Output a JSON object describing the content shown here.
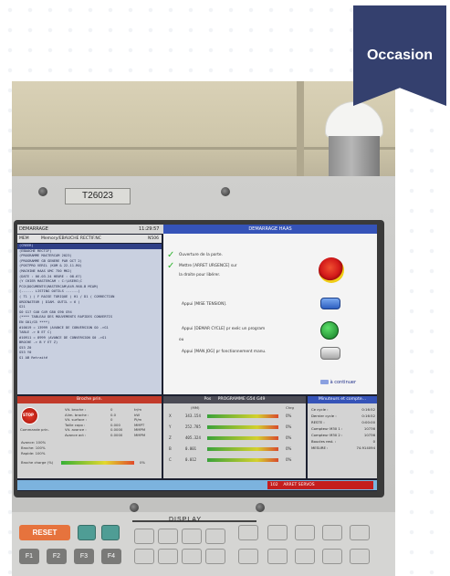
{
  "badge": {
    "label": "Occasion"
  },
  "machine": {
    "plate": "T26023"
  },
  "screen": {
    "header": {
      "left_label": "DEMARRAGE",
      "clock": "11:29:57",
      "dialog_title": "DEMARRAGE HAAS"
    },
    "subheader": {
      "mode": "MEM",
      "program": "Memory/EBAUCHE RECTIF.NC",
      "n": "N506"
    },
    "program_lines": [
      "(CREER)",
      "(EBAUCHE RECTIF)",
      "(PROGRAMME MASTERCAM 2023)",
      "(PROGRAMME GB GENERE PAR OCT 2)",
      "(POSTPRO VERIL (KOM & 22.11.R0)",
      "(MACHINE HAAS UMC 750 MK2)",
      "(DATE : 06.03.24 HEURE : 08.67)",
      "(Y CHIER MASTERCAM : C:\\USERS\\C",
      "PCO\\DOCUMENTS\\MASTERCAM\\649-968-B MCAM)",
      "",
      "(------ LISTING OUTILS ------)",
      "( T1 ) ( F RAISE TORIQUE ) H1 / D1 ( CORRECTION",
      "ORDINATEUR ) DIAM. OUTIL = 6 )",
      "",
      "G21",
      "G0 G17 G40 G49 G80 G90 G94",
      "",
      "(**** TABLEAU DES MOUVEMENTS RAPIDES CONVERTIS",
      "EN G01/G5 ****)",
      "#10019 = 13999 (AVANCE DE CONVERSION G0 ->G1",
      "TABLE -> B ET C)",
      "#10911 = 8999 (AVANCE DE CONVERSION G0 ->G1",
      "BROCHE -> B Y ET Z)",
      "",
      "G53 Z0",
      "G53 Y0",
      "G1 AB Retraité"
    ],
    "startup_steps": [
      "Ouverture de la porte.",
      "Mettre [ARRET URGENCE] sur",
      "la droite pour libérer.",
      "Appui [MISE TENSION].",
      "Appui [DEMAR CYCLE] pr exéc un program",
      "ou",
      "Appui [MAN JOG] pr fonctionnement manu."
    ],
    "continue_label": "à continuer",
    "broche": {
      "title": "Broche prin.",
      "stop_label": "STOP",
      "mode": "Commande prin.",
      "rows": [
        [
          "Vit. broche :",
          "0",
          "tr/m"
        ],
        [
          "Alim. broche :",
          "0.0",
          "kW"
        ],
        [
          "Vit. surface :",
          "0",
          "Pi/m"
        ],
        [
          "Taille copo :",
          "0.000",
          "MMPT"
        ],
        [
          "Vit. avance :",
          "0.0000",
          "MMPM"
        ],
        [
          "Avance act :",
          "0.0000",
          "MMPM"
        ]
      ],
      "overrides": [
        "Avance:  100%",
        "Broche:  100%",
        "Rapide:  100%"
      ],
      "load_label": "Broche charge (%)",
      "load_value": "0%"
    },
    "position": {
      "title": "Pos",
      "subtitle": "PROGRAMME G54 G49",
      "units_label": "(MM)",
      "load_label": "Chrg",
      "rows": [
        {
          "axis": "X",
          "value": "343.154",
          "pct": "0%"
        },
        {
          "axis": "Y",
          "value": "252.785",
          "pct": "0%"
        },
        {
          "axis": "Z",
          "value": "405.324",
          "pct": "0%"
        },
        {
          "axis": "B",
          "value": "0.001",
          "pct": "0%"
        },
        {
          "axis": "C",
          "value": "0.012",
          "pct": "0%"
        }
      ]
    },
    "timers": {
      "title": "Minuteurs et compte...",
      "rows": [
        [
          "Ce cycle :",
          "0:16:52"
        ],
        [
          "Dernier cycle :",
          "0:16:52"
        ],
        [
          "RESTE :",
          "0:00:00"
        ],
        [
          "Compteur M30 1 :",
          "10736"
        ],
        [
          "Compteur M30 2 :",
          "10736"
        ],
        [
          "Boucles rest. :",
          "0"
        ],
        [
          "MESURE :",
          "74.914094"
        ]
      ]
    },
    "alarm": {
      "code": "102",
      "text": "ARRET SERVOS"
    }
  },
  "keypad": {
    "reset": "RESET",
    "display_label": "DISPLAY",
    "f_keys": [
      "F1",
      "F2",
      "F3",
      "F4"
    ]
  }
}
